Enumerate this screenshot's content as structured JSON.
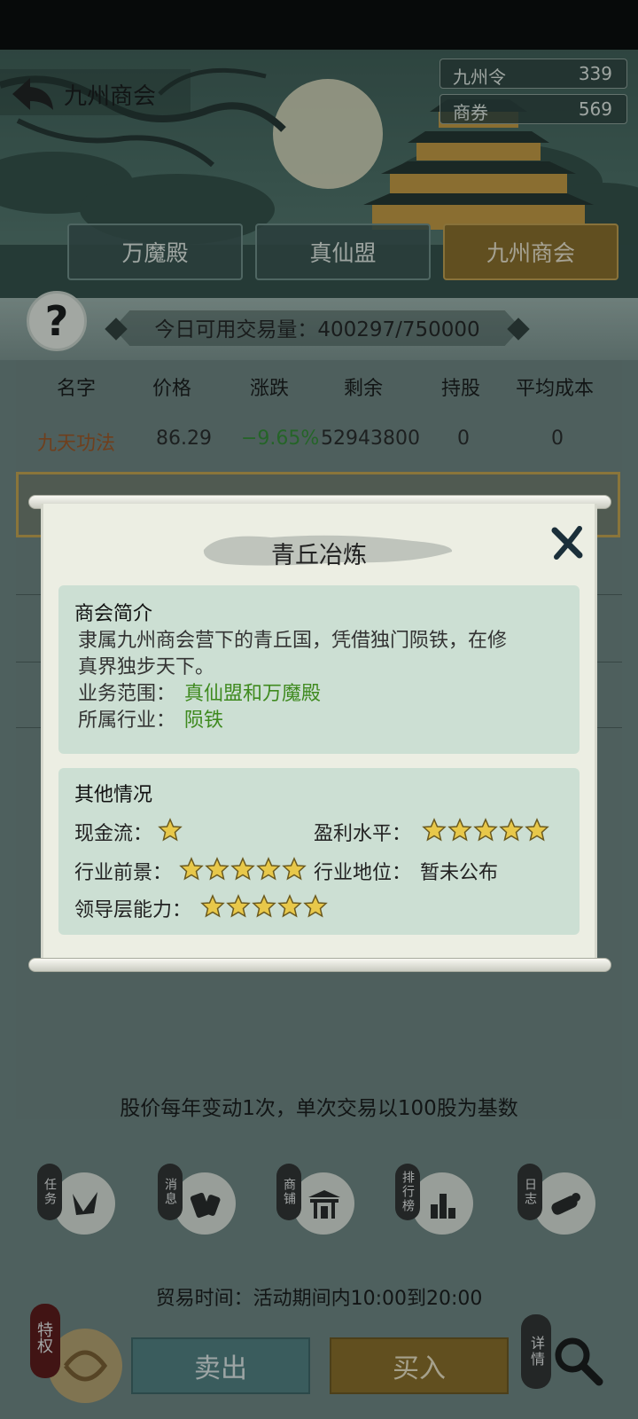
{
  "header": {
    "title": "九州商会",
    "currencies": [
      {
        "label": "九州令",
        "value": "339"
      },
      {
        "label": "商券",
        "value": "569"
      }
    ]
  },
  "tabs": [
    {
      "label": "万魔殿",
      "active": false
    },
    {
      "label": "真仙盟",
      "active": false
    },
    {
      "label": "九州商会",
      "active": true
    }
  ],
  "volume": {
    "text": "今日可用交易量：400297/750000"
  },
  "table": {
    "columns": [
      "名字",
      "价格",
      "涨跌",
      "剩余",
      "持股",
      "平均成本"
    ],
    "rows": [
      {
        "name": "九天功法",
        "price": "86.29",
        "change": "−9.65%",
        "remaining": "52943800",
        "held": "0",
        "avg_cost": "0"
      }
    ]
  },
  "footnote": "股价每年变动1次，单次交易以100股为基数",
  "bottom_nav": [
    {
      "tag": "任务",
      "icon": "task-icon"
    },
    {
      "tag": "消息",
      "icon": "message-icon"
    },
    {
      "tag": "商铺",
      "icon": "shop-icon"
    },
    {
      "tag": "排行榜",
      "icon": "ranking-icon"
    },
    {
      "tag": "日志",
      "icon": "log-icon"
    }
  ],
  "trade_time": "贸易时间：活动期间内10:00到20:00",
  "actions": {
    "sell": "卖出",
    "buy": "买入",
    "perk": "特权",
    "detail": "详情"
  },
  "modal": {
    "title": "青丘冶炼",
    "intro": {
      "heading": "商会简介",
      "line1": "隶属九州商会营下的青丘国，凭借独门陨铁，在修",
      "line2": "真界独步天下。",
      "scope_label": "业务范围：",
      "scope_value": "真仙盟和万魔殿",
      "industry_label": "所属行业：",
      "industry_value": "陨铁"
    },
    "other": {
      "heading": "其他情况",
      "cashflow_label": "现金流：",
      "cashflow_stars": 1,
      "profit_label": "盈利水平：",
      "profit_stars": 5,
      "prospect_label": "行业前景：",
      "prospect_stars": 5,
      "position_label": "行业地位：",
      "position_value": "暂未公布",
      "leadership_label": "领导层能力：",
      "leadership_stars": 5
    }
  },
  "colors": {
    "accent_gold": "#8a6a22",
    "positive_green": "#3f8a1f",
    "loss_green": "#2e8b2e",
    "name_orange": "#a0521e"
  }
}
